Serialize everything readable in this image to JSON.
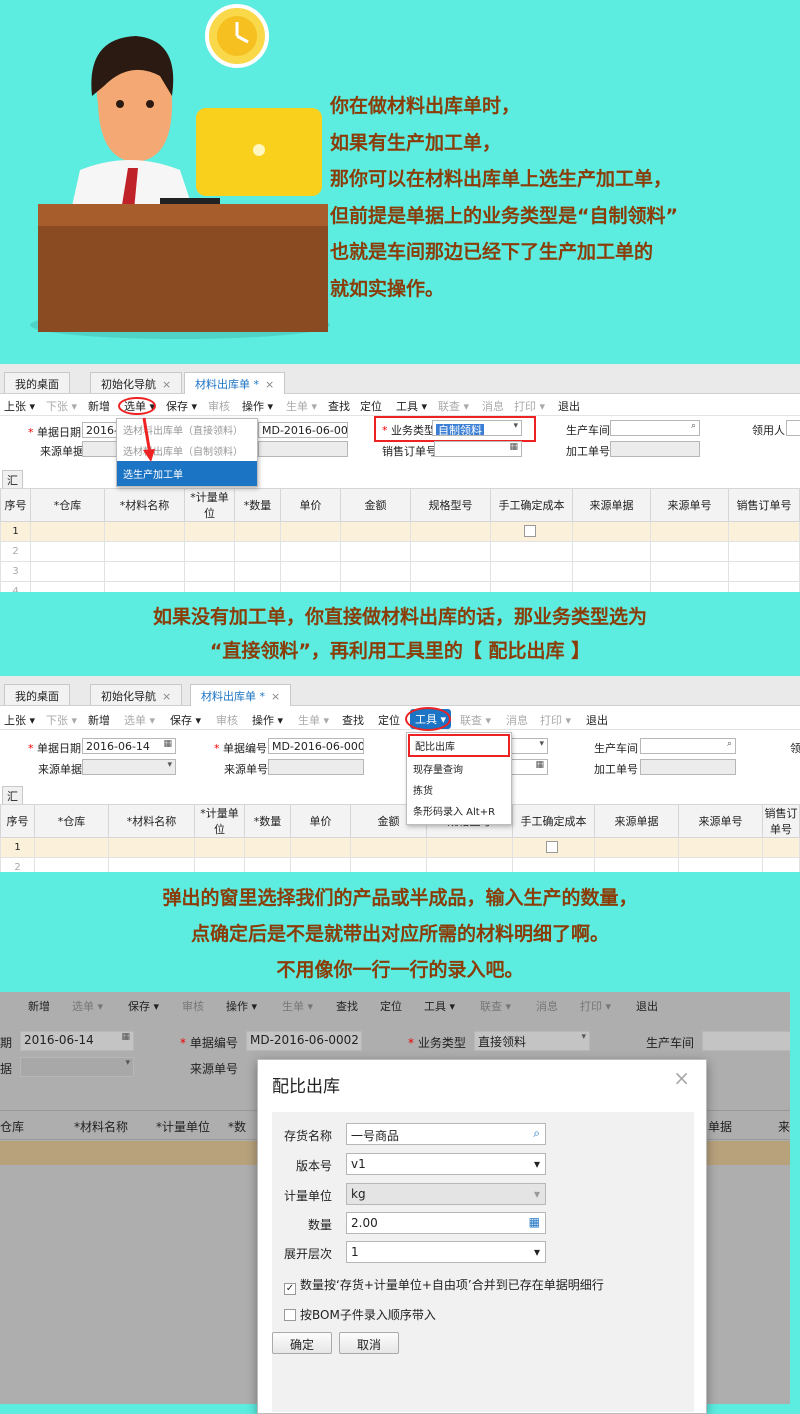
{
  "intro": {
    "lines": [
      "你在做材料出库单时，",
      "如果有生产加工单，",
      "那你可以在材料出库单上选生产加工单，",
      "但前提是单据上的业务类型是“自制领料”",
      "也就是车间那边已经下了生产加工单的",
      "就如实操作。"
    ]
  },
  "caption1": {
    "line1": "如果没有加工单，你直接做材料出库的话，那业务类型选为",
    "line2": "“直接领料”，再利用工具里的【 配比出库 】"
  },
  "caption2": {
    "line1": "弹出的窗里选择我们的产品或半成品，输入生产的数量，",
    "line2": "点确定后是不是就带出对应所需的材料明细了啊。",
    "line3": "不用像你一行一行的录入吧。"
  },
  "tabs": {
    "desk": "我的桌面",
    "guide": "初始化导航",
    "doc": "材料出库单 *"
  },
  "toolbar": {
    "prev": "上张 ▾",
    "next": "下张 ▾",
    "new": "新增",
    "select": "选单 ▾",
    "save": "保存 ▾",
    "audit": "审核",
    "ops": "操作 ▾",
    "gen": "生单 ▾",
    "find": "查找",
    "locate": "定位",
    "tools": "工具 ▾",
    "link": "联查 ▾",
    "msg": "消息",
    "print": "打印 ▾",
    "exit": "退出"
  },
  "form": {
    "date_label": "单据日期",
    "date_value": "2016-06-14",
    "date_short": "2016-0",
    "no_label": "单据编号",
    "no_value": "MD-2016-06-0002",
    "type_label": "业务类型",
    "type_value_self": "自制领料",
    "type_value_direct": "直接领料",
    "workshop_label": "生产车间",
    "receiver_label": "领用人",
    "receiver_short": "领",
    "source_doc_label": "来源单据",
    "source_no_label": "来源单号",
    "sales_order_label": "销售订单号",
    "process_no_label": "加工单号"
  },
  "subtabs": {
    "detail": "明细",
    "summary": "汇总"
  },
  "grid": {
    "headers": [
      "序号",
      "*仓库",
      "*材料名称",
      "*计量单位",
      "*数量",
      "单价",
      "金额",
      "规格型号",
      "手工确定成本",
      "来源单据",
      "来源单号",
      "销售订单号"
    ],
    "headers2": [
      "序号",
      "*仓库",
      "*材料名称",
      "*计量单位",
      "*数量",
      "单价",
      "金额",
      "规格型号",
      "手工确定成本",
      "来源单据",
      "来源单号",
      "销售订单号"
    ],
    "rows1": [
      "1",
      "2",
      "3",
      "4"
    ],
    "rows2": [
      "1",
      "2"
    ]
  },
  "select_menu": {
    "items": [
      "选材料出库单（直接领料）",
      "选材料出库单（自制领料）",
      "选生产加工单"
    ]
  },
  "tools_menu": {
    "items": [
      "配比出库",
      "现存量查询",
      "拣货",
      "条形码录入 Alt+R"
    ]
  },
  "shot3": {
    "toolbar": [
      "新增",
      "选单 ▾",
      "保存 ▾",
      "审核",
      "操作 ▾",
      "生单 ▾",
      "查找",
      "定位",
      "工具 ▾",
      "联查 ▾",
      "消息",
      "打印 ▾",
      "退出"
    ],
    "date_label": "期",
    "date_value": "2016-06-14",
    "no_label": "单据编号",
    "no_value": "MD-2016-06-0002",
    "type_label": "业务类型",
    "type_value": "直接领料",
    "workshop_label": "生产车间",
    "src_label": "据",
    "src_no_label": "来源单号",
    "h_warehouse": "仓库",
    "h_material": "*材料名称",
    "h_unit": "*计量单位",
    "h_qty": "*数",
    "h_src": "单据",
    "h_src2": "来"
  },
  "dialog": {
    "title": "配比出库",
    "close": "×",
    "inv_label": "存货名称",
    "inv_value": "一号商品",
    "ver_label": "版本号",
    "ver_value": "v1",
    "unit_label": "计量单位",
    "unit_value": "kg",
    "qty_label": "数量",
    "qty_value": "2.00",
    "level_label": "展开层次",
    "level_value": "1",
    "check1": "数量按‘存货+计量单位+自由项’合并到已存在单据明细行",
    "check2": "按BOM子件录入顺序带入",
    "ok": "确定",
    "cancel": "取消"
  },
  "colors": {
    "background": "#5cece0",
    "caption": "#8a3d08",
    "highlight": "#e22222",
    "menu_selected": "#1c74c4"
  }
}
